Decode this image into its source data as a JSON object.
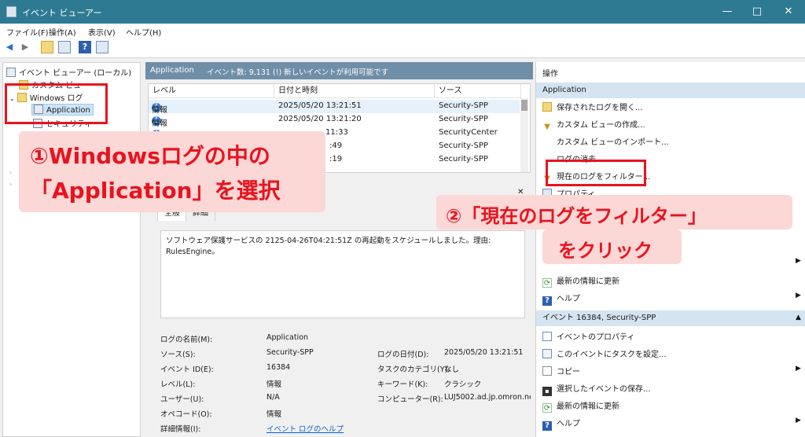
{
  "window": {
    "title": "イベント ビューアー",
    "minimize": "—",
    "maximize": "□",
    "close": "✕"
  },
  "menu": [
    "ファイル(F)",
    "操作(A)",
    "表示(V)",
    "ヘルプ(H)"
  ],
  "toolbar_icons": [
    "back-icon",
    "forward-icon",
    "folder-up-icon",
    "console-icon",
    "help-icon",
    "properties-icon"
  ],
  "tree": {
    "root": "イベント ビューアー (ローカル)",
    "custom_views": "カスタム ビュー",
    "windows_logs": "Windows ログ",
    "application": "Application",
    "security": "セキュリティ"
  },
  "event_header": {
    "name": "Application",
    "info": "イベント数: 9,131 (!) 新しいイベントが利用可能です"
  },
  "grid": {
    "columns": [
      "レベル",
      "日付と時刻",
      "ソース"
    ],
    "rows": [
      {
        "level": "情報",
        "datetime": "2025/05/20 13:21:51",
        "source": "Security-SPP"
      },
      {
        "level": "情報",
        "datetime": "2025/05/20 13:21:20",
        "source": "Security-SPP"
      },
      {
        "level": "",
        "datetime": "11:33",
        "source": "SecurityCenter"
      },
      {
        "level": "",
        "datetime": ":49",
        "source": "Security-SPP"
      },
      {
        "level": "",
        "datetime": ":19",
        "source": "Security-SPP"
      }
    ]
  },
  "detail": {
    "close_glyph": "✕",
    "tabs": [
      "全般",
      "詳細"
    ],
    "description": "ソフトウェア保護サービスの 2125-04-26T04:21:51Z の再起動をスケジュールしました。理由: RulesEngine。",
    "props_left": [
      {
        "label": "ログの名前(M):",
        "value": "Application"
      },
      {
        "label": "ソース(S):",
        "value": "Security-SPP"
      },
      {
        "label": "イベント ID(E):",
        "value": "16384"
      },
      {
        "label": "レベル(L):",
        "value": "情報"
      },
      {
        "label": "ユーザー(U):",
        "value": "N/A"
      },
      {
        "label": "オペコード(O):",
        "value": "情報"
      },
      {
        "label": "詳細情報(I):",
        "value": "イベント ログのヘルプ"
      }
    ],
    "props_right": [
      {
        "label": "ログの日付(D):",
        "value": "2025/05/20 13:21:51"
      },
      {
        "label": "タスクのカテゴリ(Y):",
        "value": "なし"
      },
      {
        "label": "キーワード(K):",
        "value": "クラシック"
      },
      {
        "label": "コンピューター(R):",
        "value": "LUJ5002.ad.jp.omron.ne"
      }
    ]
  },
  "actions": {
    "title": "操作",
    "section1": "Application",
    "items1": [
      {
        "label": "保存されたログを開く...",
        "icon": "open-log-icon"
      },
      {
        "label": "カスタム ビューの作成...",
        "icon": "filter-icon"
      },
      {
        "label": "カスタム ビューのインポート...",
        "icon": ""
      },
      {
        "label": "ログの消去...",
        "icon": ""
      },
      {
        "label": "現在のログをフィルター...",
        "icon": "filter-icon"
      },
      {
        "label": "プロパティ",
        "icon": "properties-icon"
      }
    ],
    "items1_bottom": [
      {
        "label": "最新の情報に更新",
        "icon": "refresh-icon"
      },
      {
        "label": "ヘルプ",
        "icon": "help-icon"
      }
    ],
    "section2": "イベント 16384, Security-SPP",
    "items2": [
      {
        "label": "イベントのプロパティ",
        "icon": "event-properties-icon"
      },
      {
        "label": "このイベントにタスクを設定...",
        "icon": "task-icon"
      },
      {
        "label": "コピー",
        "icon": "copy-icon"
      },
      {
        "label": "選択したイベントの保存...",
        "icon": "save-icon"
      },
      {
        "label": "最新の情報に更新",
        "icon": "refresh-icon"
      },
      {
        "label": "ヘルプ",
        "icon": "help-icon"
      }
    ]
  },
  "callouts": {
    "one_line1": "①Windowsログの中の",
    "one_line2": "「Application」を選択",
    "two_line1": "②「現在のログをフィルター」",
    "two_line2": "をクリック"
  },
  "colors": {
    "titlebar": "#2e7a92",
    "accent_red": "#e8131f",
    "callout_bg": "#fbd7d5",
    "event_header": "#6f8ea8",
    "section_bg": "#d5e4f1"
  }
}
